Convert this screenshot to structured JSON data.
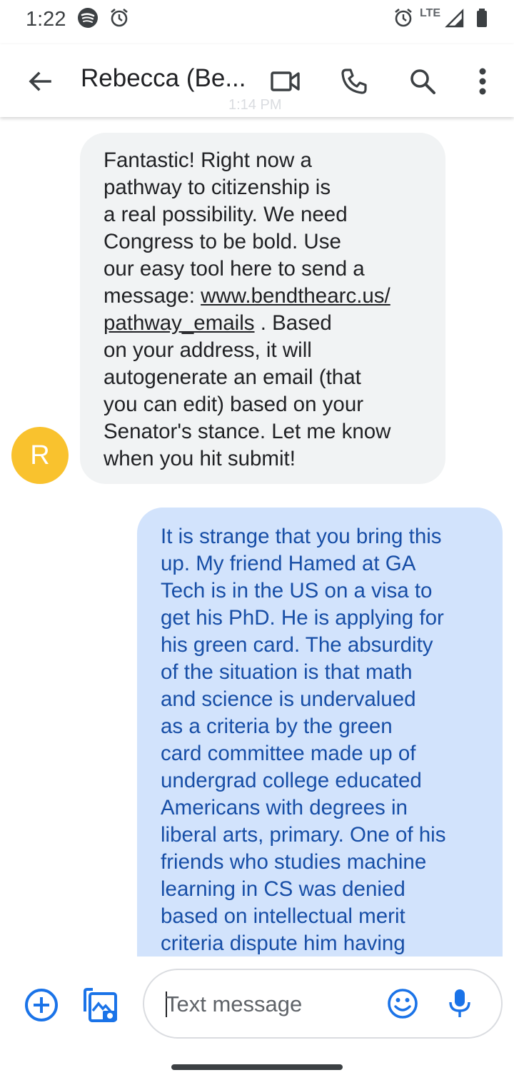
{
  "status_bar": {
    "time": "1:22",
    "network": "LTE",
    "icons": [
      "spotify-icon",
      "alarm-icon",
      "alarm-icon",
      "signal-icon",
      "battery-icon"
    ]
  },
  "app_bar": {
    "contact_name": "Rebecca (Be...",
    "ghost_timestamp": "1:14 PM",
    "icons": [
      "back-arrow-icon",
      "video-call-icon",
      "phone-icon",
      "search-icon",
      "more-vert-icon"
    ]
  },
  "messages": [
    {
      "direction": "incoming",
      "avatar_letter": "R",
      "avatar_color": "#f9c22e",
      "text_before_link": "Fantastic! Right now a\npathway to citizenship is\na real possibility. We need\nCongress to be bold. Use\nour easy tool here to send a\nmessage: ",
      "link": "www.bendthearc.us/\npathway_emails",
      "text_after_link": " . Based\non your address, it will\nautogenerate an email (that\nyou can edit) based on your\nSenator's stance. Let me know\nwhen you hit submit!"
    },
    {
      "direction": "outgoing",
      "text": "It is strange that you bring this\nup. My friend Hamed at GA\nTech is in the US on a visa to\nget his PhD. He is applying for\nhis green card. The absurdity\nof the situation is that math\nand science is undervalued\nas a criteria by the green\ncard committee made up of\nundergrad college educated\nAmericans with degrees in\nliberal arts, primary. One of his\nfriends who studies machine\nlearning in CS was denied\nbased on intellectual merit\ncriteria dispute him having"
    }
  ],
  "compose": {
    "placeholder": "Text message",
    "value": "",
    "icons": [
      "add-icon",
      "gallery-icon",
      "emoji-icon",
      "mic-icon"
    ]
  },
  "colors": {
    "accent": "#1a73e8",
    "incoming_bubble": "#f1f3f4",
    "outgoing_bubble": "#d2e3fc",
    "outgoing_text": "#174ea6"
  }
}
